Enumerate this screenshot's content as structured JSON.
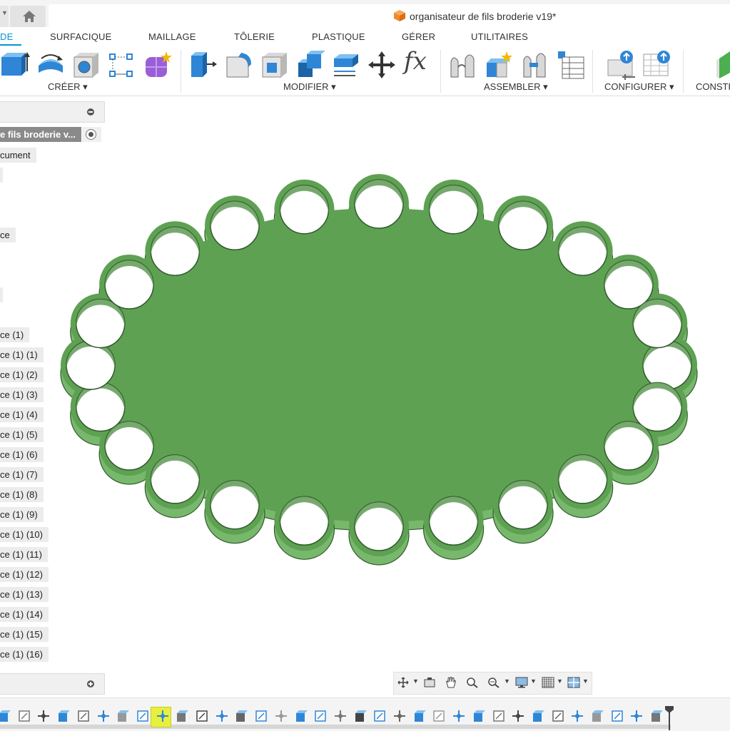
{
  "window": {
    "title": "organisateur de fils broderie v19*"
  },
  "ribbon": {
    "tabs": [
      {
        "label": "DE",
        "active": true
      },
      {
        "label": "SURFACIQUE"
      },
      {
        "label": "MAILLAGE"
      },
      {
        "label": "TÔLERIE"
      },
      {
        "label": "PLASTIQUE"
      },
      {
        "label": "GÉRER"
      },
      {
        "label": "UTILITAIRES"
      }
    ],
    "groups": [
      {
        "label": "CRÉER ▾"
      },
      {
        "label": "MODIFIER ▾"
      },
      {
        "label": "ASSEMBLER ▾"
      },
      {
        "label": "CONFIGURER ▾"
      },
      {
        "label": "CONSTR"
      }
    ],
    "tools": [
      "extrude-icon",
      "revolve-icon",
      "hole-icon",
      "sketch-pattern-icon",
      "form-icon",
      "press-pull-icon",
      "fillet-icon",
      "shell-icon",
      "combine-icon",
      "offset-face-icon",
      "move-icon",
      "parameters-icon",
      "joint-icon",
      "new-component-icon",
      "as-built-joint-icon",
      "bom-table-icon",
      "configure-icon",
      "configure-table-icon"
    ],
    "accent_color": "#0696d7"
  },
  "browser": {
    "root": "e fils broderie v...",
    "items": [
      "cument",
      "",
      "ce",
      "",
      "ce (1)",
      "ce (1) (1)",
      "ce (1) (2)",
      "ce (1) (3)",
      "ce (1) (4)",
      "ce (1) (5)",
      "ce (1) (6)",
      "ce (1) (7)",
      "ce (1) (8)",
      "ce (1) (9)",
      "ce (1) (10)",
      "ce (1) (11)",
      "ce (1) (12)",
      "ce (1) (13)",
      "ce (1) (14)",
      "ce (1) (15)",
      "ce (1) (16)"
    ]
  },
  "model": {
    "body_color": "#5ea153",
    "edge_color": "#2f5a2a",
    "side_color": "#78b86c",
    "hole_count": 24
  },
  "navbar": {
    "icons": [
      "orbit-icon",
      "look-at-icon",
      "pan-icon",
      "zoom-icon",
      "zoom-window-icon",
      "display-settings-icon",
      "grid-icon",
      "viewports-icon"
    ]
  },
  "timeline": {
    "item_count": 34,
    "highlighted_index": 8
  }
}
